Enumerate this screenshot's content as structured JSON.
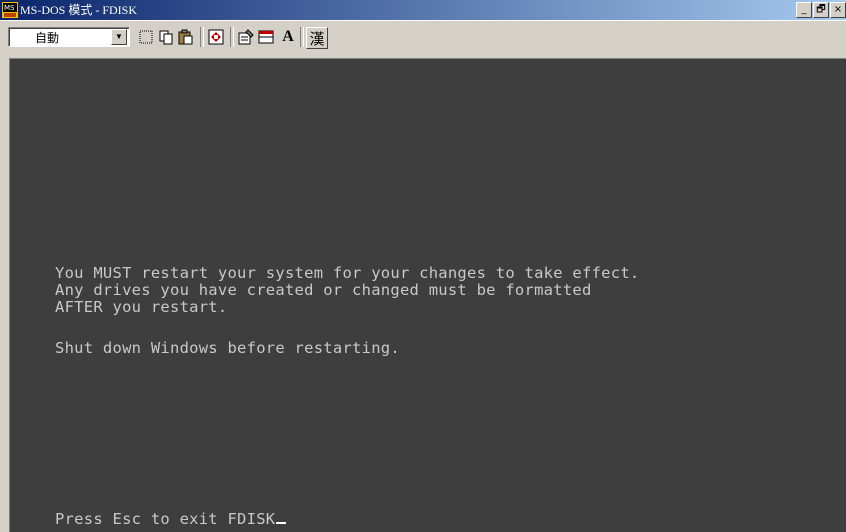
{
  "window": {
    "title": "MS-DOS 模式 - FDISK",
    "controls": [
      "_",
      "🗗",
      "×"
    ]
  },
  "toolbar": {
    "font_size_value": "自動",
    "bold_glyph": "A",
    "kanji_glyph": "漢"
  },
  "console": {
    "line1": "You MUST restart your system for your changes to take effect.",
    "line2": "Any drives you have created or changed must be formatted",
    "line3": "AFTER you restart.",
    "line4": "Shut down Windows before restarting.",
    "prompt": "Press Esc to exit FDISK"
  },
  "colors": {
    "console_bg": "#3e3e3e",
    "console_fg": "#c8c8c8",
    "titlebar_start": "#0a246a",
    "titlebar_end": "#a6caf0"
  }
}
